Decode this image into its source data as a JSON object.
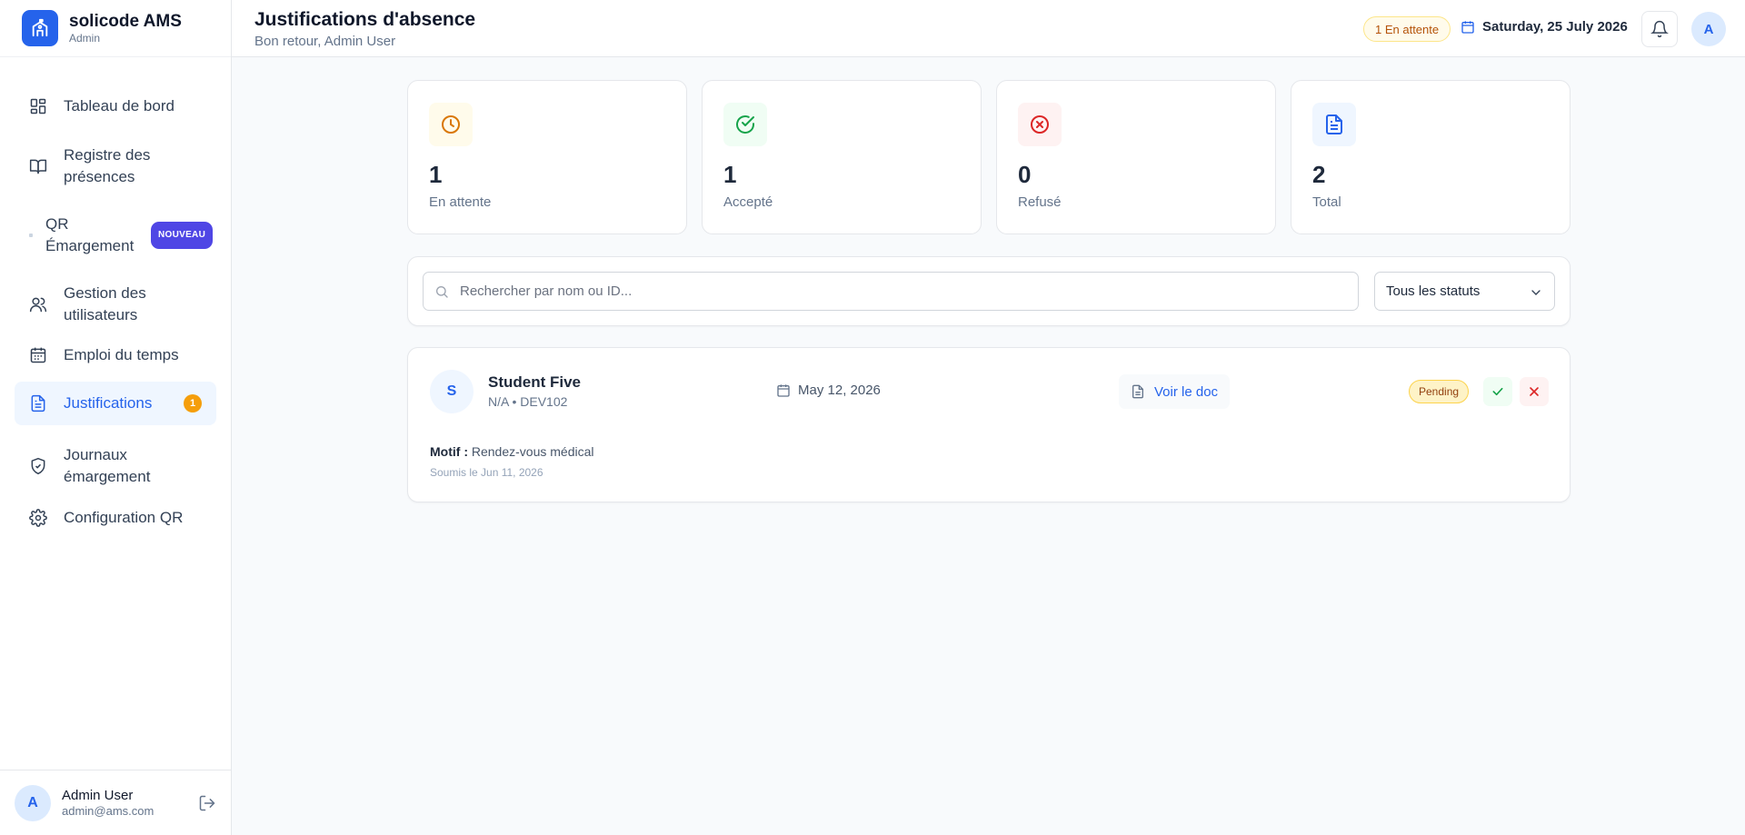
{
  "brand": {
    "name": "solicode AMS",
    "role": "Admin"
  },
  "nav": [
    {
      "label": "Tableau de bord",
      "icon": "dashboard-icon"
    },
    {
      "label": "Registre des présences",
      "icon": "book-icon"
    },
    {
      "label": "QR Émargement",
      "icon": "dot-icon",
      "badge": "NOUVEAU"
    },
    {
      "label": "Gestion des utilisateurs",
      "icon": "users-icon"
    },
    {
      "label": "Emploi du temps",
      "icon": "calendar-icon"
    },
    {
      "label": "Justifications",
      "icon": "file-icon",
      "count": "1",
      "active": true
    },
    {
      "label": "Journaux émargement",
      "icon": "shield-icon"
    },
    {
      "label": "Configuration QR",
      "icon": "gear-icon"
    }
  ],
  "user": {
    "initial": "A",
    "name": "Admin User",
    "email": "admin@ams.com"
  },
  "header": {
    "title": "Justifications d'absence",
    "subtitle": "Bon retour, Admin User",
    "pending": "1 En attente",
    "date": "Saturday, 25 July 2026",
    "avatar": "A"
  },
  "stats": [
    {
      "value": "1",
      "label": "En attente",
      "icon": "clock-icon",
      "color": "#d97706",
      "bg": "#fffbeb"
    },
    {
      "value": "1",
      "label": "Accepté",
      "icon": "check-circle-icon",
      "color": "#16a34a",
      "bg": "#f0fdf4"
    },
    {
      "value": "0",
      "label": "Refusé",
      "icon": "x-circle-icon",
      "color": "#dc2626",
      "bg": "#fef2f2"
    },
    {
      "value": "2",
      "label": "Total",
      "icon": "document-icon",
      "color": "#2563eb",
      "bg": "#eff6ff"
    }
  ],
  "filters": {
    "search_placeholder": "Rechercher par nom ou ID...",
    "status": "Tous les statuts"
  },
  "justifications": [
    {
      "initial": "S",
      "name": "Student Five",
      "meta": "N/A • DEV102",
      "date": "May 12, 2026",
      "doc_label": "Voir le doc",
      "status": "Pending",
      "reason_label": "Motif :",
      "reason": "Rendez-vous médical",
      "submitted": "Soumis le Jun 11, 2026"
    }
  ],
  "colors": {
    "accent": "#2563eb",
    "pending": "#f59e0b",
    "new_badge": "#4f46e5"
  }
}
